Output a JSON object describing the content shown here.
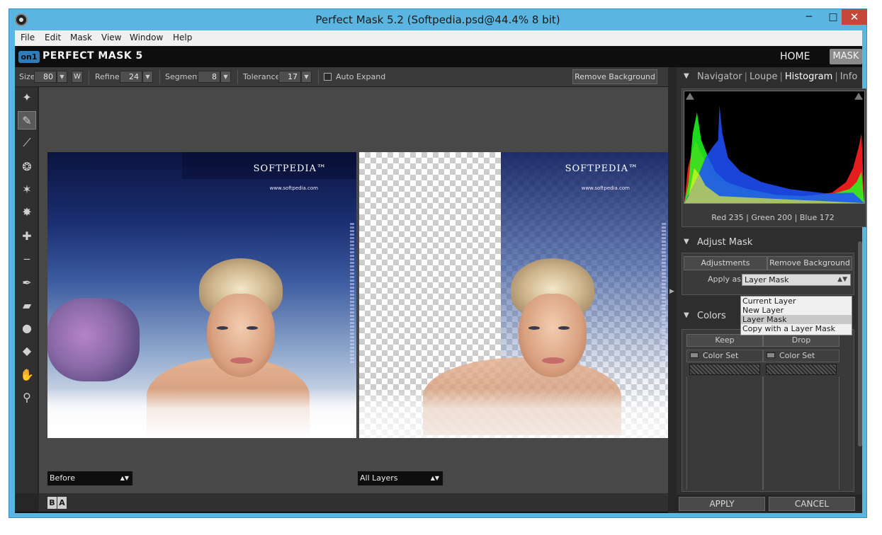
{
  "window": {
    "title": "Perfect Mask 5.2 (Softpedia.psd@44.4% 8 bit)",
    "minimize": "─",
    "maximize": "□",
    "close": "✕"
  },
  "menu": [
    "File",
    "Edit",
    "Mask",
    "View",
    "Window",
    "Help"
  ],
  "appbar": {
    "logo": "on1",
    "brand": "PERFECT MASK 5",
    "home": "HOME",
    "mask": "MASK"
  },
  "toolbar": {
    "size_label": "Size",
    "size_value": "80",
    "w_label": "W",
    "refine_label": "Refine",
    "refine_value": "24",
    "segment_label": "Segment",
    "segment_value": "8",
    "tolerance_label": "Tolerance",
    "tolerance_value": "17",
    "auto_expand_label": "Auto Expand",
    "remove_background": "Remove Background"
  },
  "tools": [
    "keep-brush-icon",
    "smart-brush-icon",
    "eyedropper-icon",
    "magic-brush-icon",
    "magic-wand-icon",
    "splatter-icon",
    "keep-eyedropper-icon",
    "drop-eyedropper-icon",
    "pen-icon",
    "eraser-icon",
    "blur-icon",
    "bucket-icon",
    "hand-icon",
    "zoom-icon"
  ],
  "canvas": {
    "watermark": "SOFTPEDIA",
    "watermark_tm": "™",
    "url": "www.softpedia.com",
    "before_view": "Before",
    "after_view": "All Layers",
    "b_button": "B",
    "a_button": "A"
  },
  "navigator": {
    "tabs": [
      "Navigator",
      "Loupe",
      "Histogram",
      "Info"
    ],
    "selected": "Histogram",
    "readout": "Red 235 | Green 200 | Blue 172"
  },
  "adjust_mask": {
    "title": "Adjust Mask",
    "adjustments": "Adjustments",
    "remove_background": "Remove Background",
    "apply_as_label": "Apply as",
    "apply_as_value": "Layer Mask",
    "options": [
      "Current Layer",
      "New Layer",
      "Layer Mask",
      "Copy with a Layer Mask"
    ],
    "selected_option": "Layer Mask"
  },
  "colors": {
    "title": "Colors",
    "keep": "Keep",
    "drop": "Drop",
    "keep_colorset": "Color Set",
    "drop_colorset": "Color Set"
  },
  "footer": {
    "apply": "APPLY",
    "cancel": "CANCEL"
  },
  "colors_theme": {
    "titlebar": "#5ab5e0",
    "close": "#c7463a",
    "panel": "#2e2e2e",
    "accent": "#2e7db8"
  }
}
